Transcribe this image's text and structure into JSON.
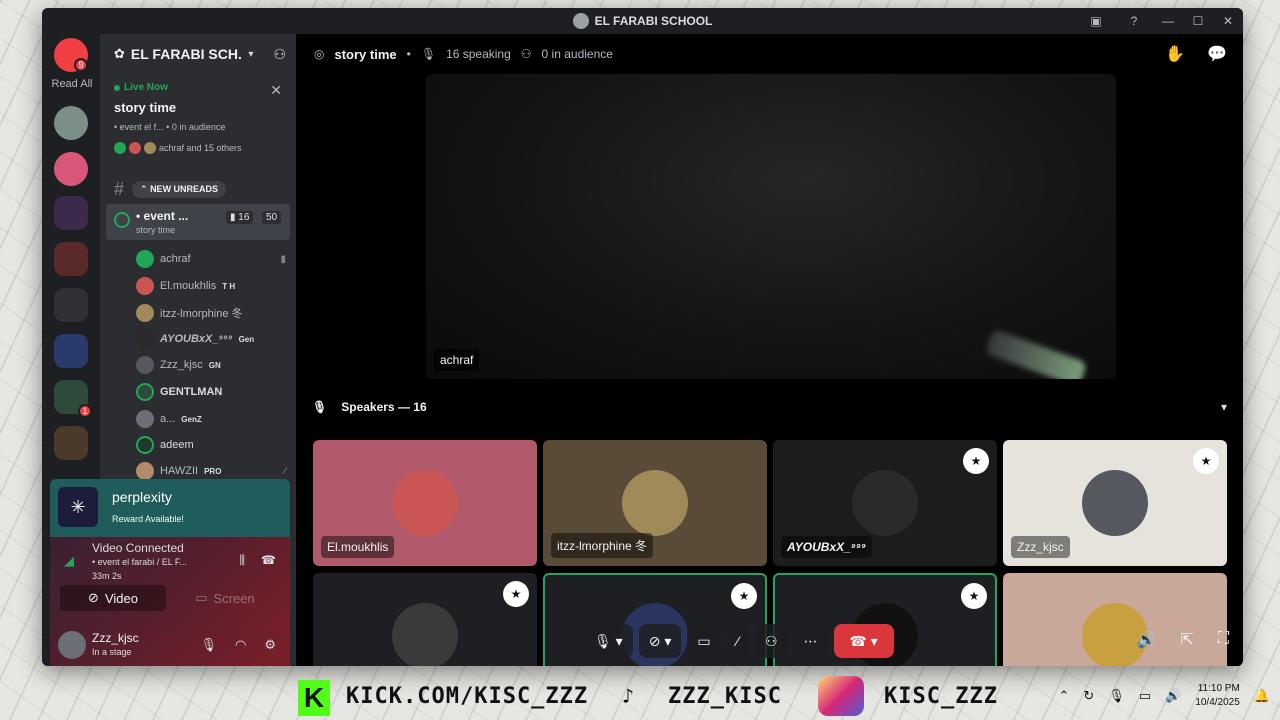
{
  "window": {
    "title": "EL FARABI SCHOOL"
  },
  "rail": {
    "read_all": "Read All",
    "home_badge": "9",
    "unread_badge": "1"
  },
  "server": {
    "name": "EL FARABI SCH..."
  },
  "live": {
    "live_now": "Live Now",
    "title": "story time",
    "meta": "• event el f...  • 0 in audience",
    "people": "achraf and 15 others"
  },
  "unreads": {
    "label": "NEW UNREADS"
  },
  "active_channel": {
    "name": "• event ...",
    "sub": "story time",
    "video_count": "16",
    "limit": "50"
  },
  "members": [
    {
      "name": "achraf",
      "tag": ""
    },
    {
      "name": "El.moukhlis",
      "tag": "T H"
    },
    {
      "name": "itzz-lmorphine 冬",
      "tag": ""
    },
    {
      "name": "AYOUBxX_⁹⁹⁹",
      "tag": "Gen"
    },
    {
      "name": "Zzz_kjsc",
      "tag": "GN"
    },
    {
      "name": "GENTLMAN",
      "tag": ""
    },
    {
      "name": "a...",
      "tag": "GenZ"
    },
    {
      "name": "adeem",
      "tag": ""
    },
    {
      "name": "HAWZII",
      "tag": "PRO"
    }
  ],
  "perplexity": {
    "title": "perplexity",
    "sub": "Reward Available!"
  },
  "voice": {
    "status": "Video Connected",
    "channel": "• event el farabi / EL F...",
    "time": "33m 2s",
    "video_label": "Video",
    "screen_label": "Screen"
  },
  "user": {
    "name": "Zzz_kjsc",
    "status": "In a stage"
  },
  "stage": {
    "title": "story time",
    "speaking": "16 speaking",
    "audience": "0 in audience",
    "featured_name": "achraf",
    "speakers_label": "Speakers — 16"
  },
  "tiles": [
    {
      "name": "El.moukhlis",
      "bg": "#b05a6b",
      "avatar": "#c95555"
    },
    {
      "name": "itzz-lmorphine 冬",
      "bg": "#5a4a38",
      "avatar": "#a08a5a"
    },
    {
      "name": "AYOUBxX_⁹⁹⁹",
      "bg": "#1c1c1c",
      "avatar": "#2a2a2a"
    },
    {
      "name": "Zzz_kjsc",
      "bg": "#e6e3dc",
      "avatar": "#55585f"
    },
    {
      "name": "",
      "bg": "#1e1f22",
      "avatar": "#3a3a3a"
    },
    {
      "name": "",
      "bg": "#1e1f22",
      "avatar": "#2a3560"
    },
    {
      "name": "",
      "bg": "#1e1f22",
      "avatar": "#111"
    },
    {
      "name": "",
      "bg": "#c9a89a",
      "avatar": "#c9a040"
    }
  ],
  "taskbar": {
    "kick": "KICK.COM/KISC_ZZZ",
    "tiktok": "ZZZ_KISC",
    "instagram": "KISC_ZZZ",
    "time": "11:10 PM",
    "date": "10/4/2025"
  },
  "colors": {
    "accent": "#23a55a",
    "danger": "#da373c",
    "brand": "#5865f2"
  }
}
